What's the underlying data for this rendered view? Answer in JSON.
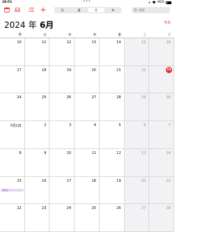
{
  "status": {
    "time": "20:51",
    "battery_text": "90%",
    "dots": "•••"
  },
  "toolbar": {
    "views": [
      "日",
      "週",
      "月",
      "年"
    ],
    "active_view_index": 2,
    "search_placeholder": "検索",
    "accent_color": "#e0312f"
  },
  "header": {
    "year": "2024",
    "nen": "年",
    "month": "6月",
    "today_label": "今日"
  },
  "weekdays": [
    "月",
    "火",
    "水",
    "木",
    "金",
    "土",
    "日"
  ],
  "weeks": [
    [
      "10",
      "11",
      "12",
      "13",
      "14",
      "15",
      "16"
    ],
    [
      "17",
      "18",
      "19",
      "20",
      "21",
      "22",
      "23"
    ],
    [
      "24",
      "25",
      "26",
      "27",
      "28",
      "29",
      "30"
    ],
    [
      "7月1日",
      "2",
      "3",
      "4",
      "5",
      "6",
      "7"
    ],
    [
      "8",
      "9",
      "10",
      "11",
      "12",
      "13",
      "14"
    ],
    [
      "15",
      "16",
      "17",
      "18",
      "19",
      "20",
      "21"
    ],
    [
      "22",
      "23",
      "24",
      "25",
      "26",
      "27",
      "28"
    ]
  ],
  "today": "23",
  "events": [
    {
      "day": "15",
      "title": "海の日",
      "color": "#e6d7f3",
      "text_color": "#8a4fbf"
    }
  ]
}
